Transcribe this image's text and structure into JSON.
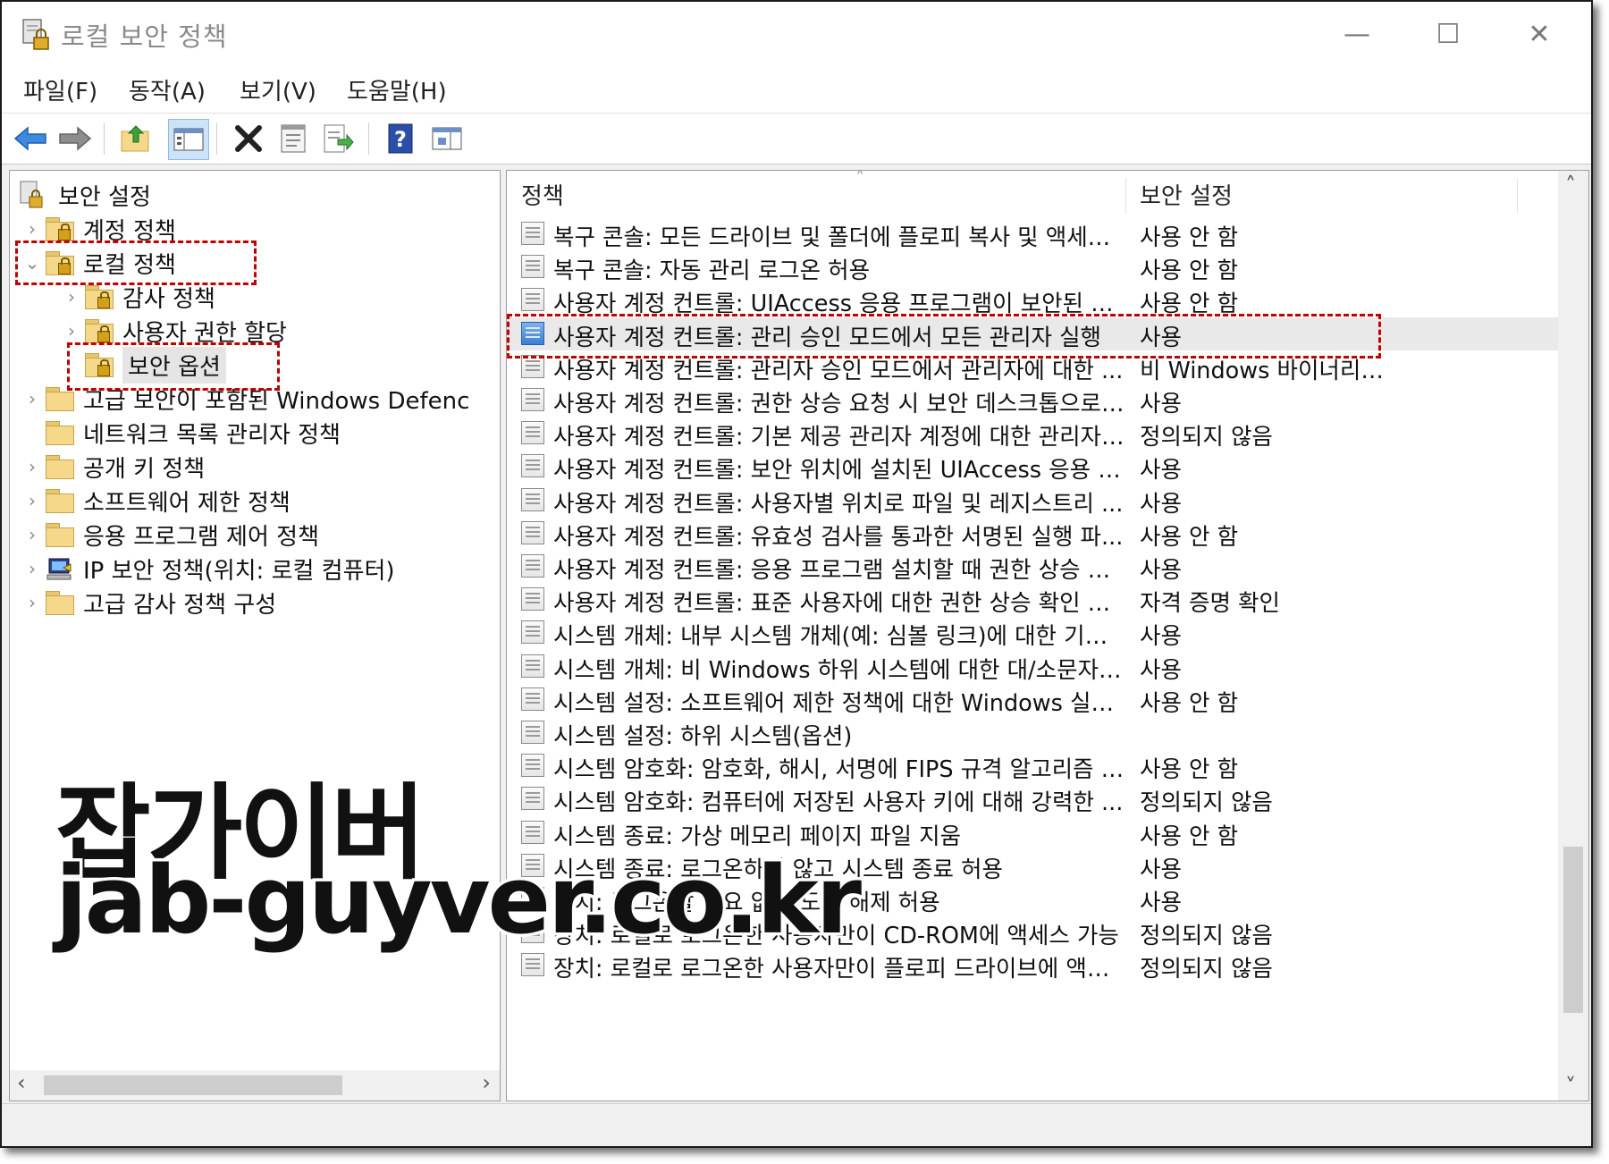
{
  "window": {
    "title": "로컬 보안 정책",
    "controls": [
      "—",
      "☐",
      "✕"
    ]
  },
  "menu": [
    "파일(F)",
    "동작(A)",
    "보기(V)",
    "도움말(H)"
  ],
  "toolbar_icons": [
    "back-arrow-icon",
    "forward-arrow-icon",
    "up-folder-icon",
    "show-hide-tree-icon",
    "delete-icon",
    "properties-icon",
    "export-list-icon",
    "help-icon",
    "mmc-icon"
  ],
  "tree": {
    "root": "보안 설정",
    "items": [
      {
        "label": "계정 정책",
        "level": 1,
        "expander": "›"
      },
      {
        "label": "로컬 정책",
        "level": 1,
        "expander": "⌄"
      },
      {
        "label": "감사 정책",
        "level": 2,
        "expander": "›"
      },
      {
        "label": "사용자 권한 할당",
        "level": 2,
        "expander": "›"
      },
      {
        "label": "보안 옵션",
        "level": 2,
        "expander": ""
      },
      {
        "label": "고급 보안이 포함된 Windows Defenc",
        "level": 1,
        "expander": "›"
      },
      {
        "label": "네트워크 목록 관리자 정책",
        "level": 1,
        "expander": ""
      },
      {
        "label": "공개 키 정책",
        "level": 1,
        "expander": "›"
      },
      {
        "label": "소프트웨어 제한 정책",
        "level": 1,
        "expander": "›"
      },
      {
        "label": "응용 프로그램 제어 정책",
        "level": 1,
        "expander": "›"
      },
      {
        "label": "IP 보안 정책(위치: 로컬 컴퓨터)",
        "level": 1,
        "expander": "›"
      },
      {
        "label": "고급 감사 정책 구성",
        "level": 1,
        "expander": "›"
      }
    ],
    "scroll_left": "‹",
    "scroll_right": "›"
  },
  "list": {
    "col_policy": "정책",
    "col_setting": "보안 설정",
    "sort_indicator": "˄",
    "scroll_up": "˄",
    "scroll_down": "˅",
    "rows": [
      {
        "policy": "복구 콘솔: 모든 드라이브 및 폴더에 플로피 복사 및 액세스 ...",
        "setting": "사용 안 함"
      },
      {
        "policy": "복구 콘솔: 자동 관리 로그온 허용",
        "setting": "사용 안 함"
      },
      {
        "policy": "사용자 계정 컨트롤: UIAccess 응용 프로그램이 보안된 데스...",
        "setting": "사용 안 함"
      },
      {
        "policy": "사용자 계정 컨트롤: 관리 승인 모드에서 모든 관리자 실행",
        "setting": "사용"
      },
      {
        "policy": "사용자 계정 컨트롤: 관리자 승인 모드에서 관리자에 대한 ...",
        "setting": "비 Windows 바이너리에..."
      },
      {
        "policy": "사용자 계정 컨트롤: 권한 상승 요청 시 보안 데스크톱으로 ...",
        "setting": "사용"
      },
      {
        "policy": "사용자 계정 컨트롤: 기본 제공 관리자 계정에 대한 관리자 ...",
        "setting": "정의되지 않음"
      },
      {
        "policy": "사용자 계정 컨트롤: 보안 위치에 설치된 UIAccess 응용 프...",
        "setting": "사용"
      },
      {
        "policy": "사용자 계정 컨트롤: 사용자별 위치로 파일 및 레지스트리 ...",
        "setting": "사용"
      },
      {
        "policy": "사용자 계정 컨트롤: 유효성 검사를 통과한 서명된 실행 파...",
        "setting": "사용 안 함"
      },
      {
        "policy": "사용자 계정 컨트롤: 응용 프로그램 설치할 때 권한 상승 확인",
        "setting": "사용"
      },
      {
        "policy": "사용자 계정 컨트롤: 표준 사용자에 대한 권한 상승 확인 방법",
        "setting": "자격 증명 확인"
      },
      {
        "policy": "시스템 개체: 내부 시스템 개체(예: 심볼 링크)에 대한 기본 ...",
        "setting": "사용"
      },
      {
        "policy": "시스템 개체: 비 Windows 하위 시스템에 대한 대/소문자 구...",
        "setting": "사용"
      },
      {
        "policy": "시스템 설정: 소프트웨어 제한 정책에 대한 Windows 실행 ...",
        "setting": "사용 안 함"
      },
      {
        "policy": "시스템 설정: 하위 시스템(옵션)",
        "setting": ""
      },
      {
        "policy": "시스템 암호화: 암호화, 해시, 서명에 FIPS 규격 알고리즘 사용",
        "setting": "사용 안 함"
      },
      {
        "policy": "시스템 암호화: 컴퓨터에 저장된 사용자 키에 대해 강력한 ...",
        "setting": "정의되지 않음"
      },
      {
        "policy": "시스템 종료: 가상 메모리 페이지 파일 지움",
        "setting": "사용 안 함"
      },
      {
        "policy": "시스템 종료: 로그온하지 않고 시스템 종료 허용",
        "setting": "사용"
      },
      {
        "policy": "장치: 로그온할 필요 없이 도킹 해제 허용",
        "setting": "사용"
      },
      {
        "policy": "장치: 로컬로 로그온한 사용자만이 CD-ROM에 액세스 가능",
        "setting": "정의되지 않음"
      },
      {
        "policy": "장치: 로컬로 로그온한 사용자만이 플로피 드라이브에 액세...",
        "setting": "정의되지 않음"
      }
    ]
  },
  "watermark": {
    "line1": "잡가이버",
    "line2": "jab-guyver.co.kr"
  },
  "colors": {
    "highlight_dash": "#c00000",
    "selected_row": "#e9e9e9",
    "folder": "#f5d889"
  }
}
